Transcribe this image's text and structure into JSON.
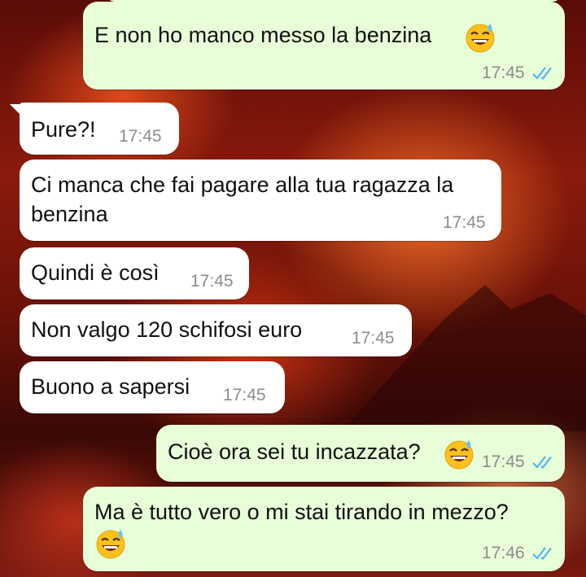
{
  "messages": [
    {
      "direction": "out",
      "text": "E non ho manco messo la benzina",
      "emoji": "sweat-smile-icon",
      "time": "17:45",
      "status": "read"
    },
    {
      "direction": "in",
      "text": "Pure?!",
      "time": "17:45"
    },
    {
      "direction": "in",
      "text_line1": "Ci manca che fai pagare alla tua ragazza la",
      "text_line2": "benzina",
      "time": "17:45"
    },
    {
      "direction": "in",
      "text": "Quindi è così",
      "time": "17:45"
    },
    {
      "direction": "in",
      "text": "Non valgo 120 schifosi euro",
      "time": "17:45"
    },
    {
      "direction": "in",
      "text": "Buono a sapersi",
      "time": "17:45"
    },
    {
      "direction": "out",
      "text": "Cioè ora sei tu incazzata?",
      "emoji": "sweat-smile-icon",
      "time": "17:45",
      "status": "read"
    },
    {
      "direction": "out",
      "text": "Ma è tutto vero o mi stai tirando in mezzo?",
      "emoji": "sweat-smile-icon",
      "time": "17:46",
      "status": "read"
    }
  ],
  "colors": {
    "incoming_bubble": "#ffffff",
    "outgoing_bubble": "#e7fed8",
    "read_ticks": "#4fb6ec",
    "timestamp": "#8c8c8c"
  }
}
